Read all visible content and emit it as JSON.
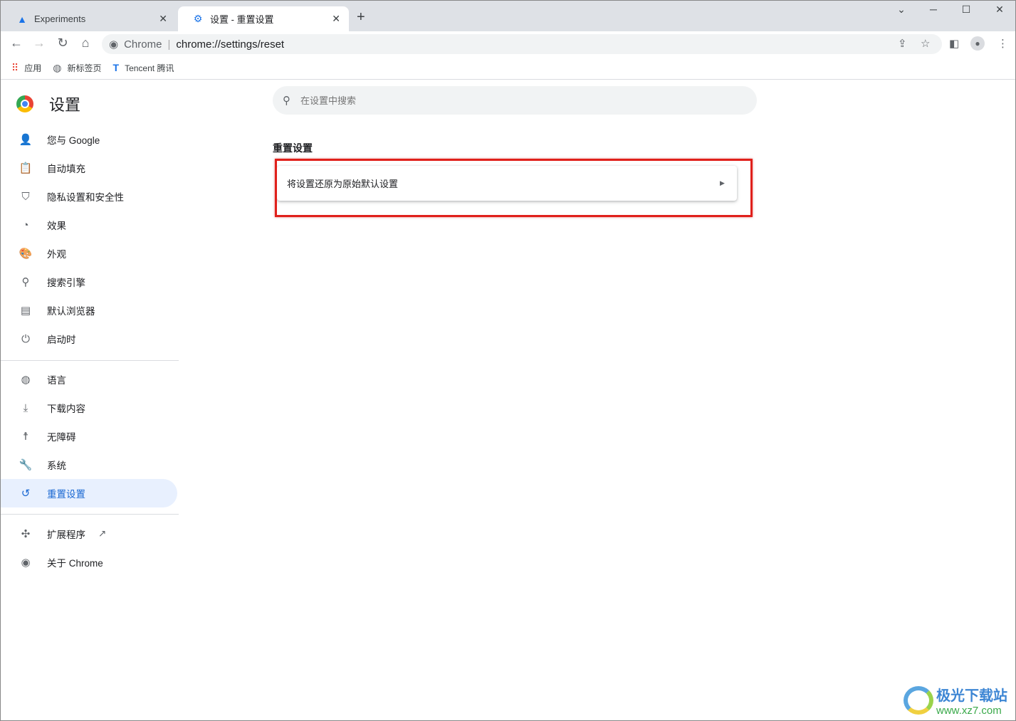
{
  "tabs": [
    {
      "label": "Experiments",
      "icon": "flask-icon"
    },
    {
      "label": "设置 - 重置设置",
      "icon": "gear-icon",
      "active": true
    }
  ],
  "omnibox": {
    "site": "Chrome",
    "url": "chrome://settings/reset"
  },
  "bookmarks": [
    {
      "label": "应用",
      "icon": "apps-icon"
    },
    {
      "label": "新标签页",
      "icon": "globe-icon"
    },
    {
      "label": "Tencent 腾讯",
      "icon": "tencent-icon"
    }
  ],
  "settings": {
    "title": "设置",
    "search_placeholder": "在设置中搜索"
  },
  "sidebar": {
    "group1": [
      {
        "label": "您与 Google",
        "icon": "person-icon"
      },
      {
        "label": "自动填充",
        "icon": "clipboard-icon"
      },
      {
        "label": "隐私设置和安全性",
        "icon": "shield-icon"
      },
      {
        "label": "效果",
        "icon": "speedometer-icon"
      },
      {
        "label": "外观",
        "icon": "palette-icon"
      },
      {
        "label": "搜索引擎",
        "icon": "search-icon"
      },
      {
        "label": "默认浏览器",
        "icon": "browser-icon"
      },
      {
        "label": "启动时",
        "icon": "power-icon"
      }
    ],
    "group2": [
      {
        "label": "语言",
        "icon": "globe-icon"
      },
      {
        "label": "下载内容",
        "icon": "download-icon"
      },
      {
        "label": "无障碍",
        "icon": "accessibility-icon"
      },
      {
        "label": "系统",
        "icon": "wrench-icon"
      },
      {
        "label": "重置设置",
        "icon": "restore-icon",
        "active": true
      }
    ],
    "group3": [
      {
        "label": "扩展程序",
        "icon": "puzzle-icon"
      },
      {
        "label": "关于 Chrome",
        "icon": "chrome-icon"
      }
    ]
  },
  "main": {
    "section_title": "重置设置",
    "reset_row": "将设置还原为原始默认设置"
  },
  "highlight_color": "#e0201b",
  "watermark": {
    "name": "极光下载站",
    "url": "www.xz7.com"
  }
}
